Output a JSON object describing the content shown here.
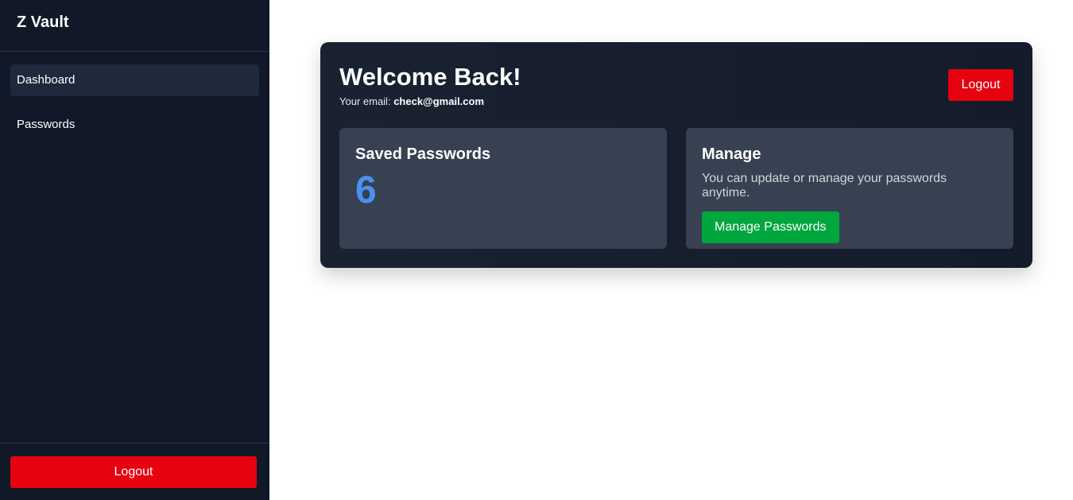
{
  "sidebar": {
    "brand": "Z Vault",
    "items": [
      {
        "label": "Dashboard",
        "active": true
      },
      {
        "label": "Passwords",
        "active": false
      }
    ],
    "logout_label": "Logout"
  },
  "main": {
    "title": "Welcome Back!",
    "email_prefix": "Your email:",
    "email": "check@gmail.com",
    "logout_label": "Logout",
    "saved": {
      "title": "Saved Passwords",
      "count": "6"
    },
    "manage": {
      "title": "Manage",
      "description": "You can update or manage your passwords anytime.",
      "button_label": "Manage Passwords"
    }
  },
  "colors": {
    "sidebar_bg": "#111827",
    "danger": "#e6020f",
    "success": "#00a63e",
    "count_accent": "#4a90f0"
  }
}
